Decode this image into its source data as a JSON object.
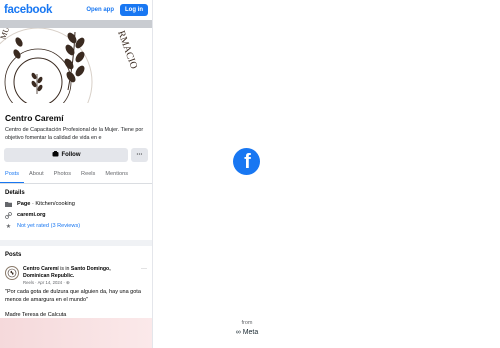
{
  "topbar": {
    "logo": "facebook",
    "open_app": "Open app",
    "login": "Log in"
  },
  "profile": {
    "name": "Centro Caremí",
    "bio": "Centro de Capacitación Profesional de la Mujer. Tiene por objetivo fomentar la calidad de vida en e",
    "follow_label": "Follow",
    "more_label": "···"
  },
  "tabs": [
    "Posts",
    "About",
    "Photos",
    "Reels",
    "Mentions"
  ],
  "details": {
    "title": "Details",
    "page_label": "Page",
    "category": "· Kitchen/cooking",
    "website": "caremi.org",
    "rating": "Not yet rated (3 Reviews)"
  },
  "posts": {
    "title": "Posts",
    "author": "Centro Caremí",
    "is_in": "is in",
    "location": "Santo Domingo, Dominican Republic.",
    "meta": "Reels · Apr 14, 2024 · ",
    "text": "\"Por cada gota de dulzura que alguien da, hay una gota menos de amargura en el mundo\"",
    "signature": "Madre Teresa de Calcuta",
    "menu": "···"
  },
  "right_panel": {
    "from": "from",
    "meta": "Meta"
  },
  "colors": {
    "brand": "#1877f2",
    "muted": "#65676b",
    "button_grey": "#e4e6eb"
  }
}
